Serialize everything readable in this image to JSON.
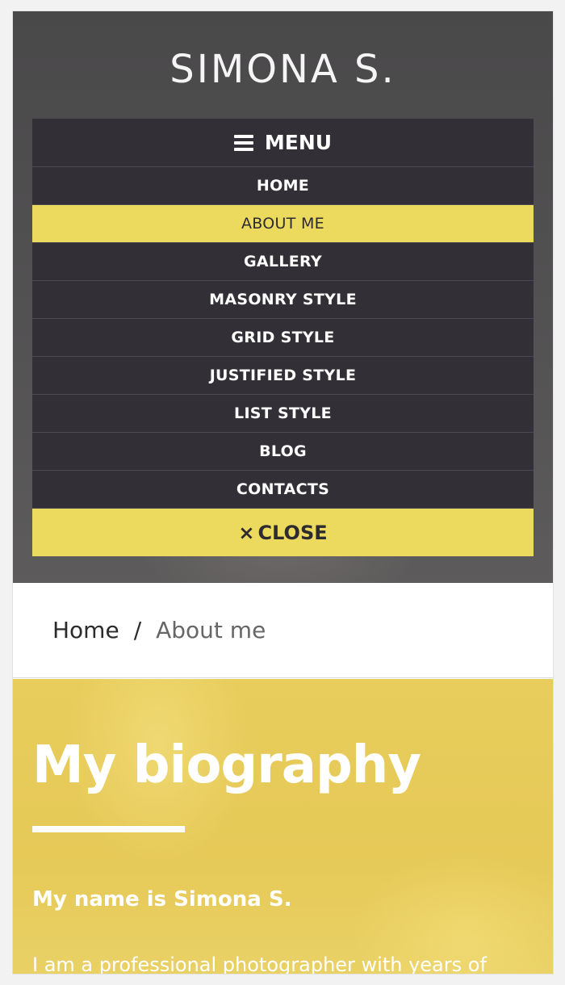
{
  "site": {
    "brand": "SIMONA S."
  },
  "menu": {
    "toggle_label": "MENU",
    "items": [
      {
        "label": "HOME"
      },
      {
        "label": "ABOUT ME",
        "active": true
      },
      {
        "label": "GALLERY"
      },
      {
        "label": "MASONRY STYLE"
      },
      {
        "label": "GRID STYLE"
      },
      {
        "label": "JUSTIFIED STYLE"
      },
      {
        "label": "LIST STYLE"
      },
      {
        "label": "BLOG"
      },
      {
        "label": "CONTACTS"
      }
    ],
    "close_icon": "×",
    "close_label": "CLOSE"
  },
  "breadcrumb": {
    "home": "Home",
    "separator": "/",
    "current": "About me"
  },
  "bio": {
    "title": "My biography",
    "name_line": "My name is Simona S.",
    "intro": "I am a professional photographer with years of"
  },
  "colors": {
    "accent": "#ebda5e",
    "menu_bg": "#323036",
    "section_bg": "#e8cd5c"
  }
}
